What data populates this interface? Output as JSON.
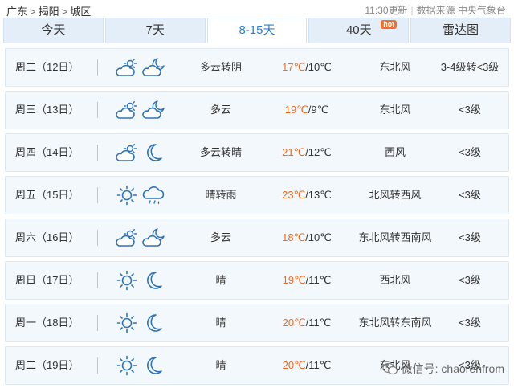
{
  "breadcrumb": {
    "province": "广东",
    "city": "揭阳",
    "district": "城区",
    "sep": ">"
  },
  "meta": {
    "updated": "11:30更新",
    "source": "数据来源 中央气象台",
    "divider": "|"
  },
  "tabs": [
    {
      "label": "今天"
    },
    {
      "label": "7天"
    },
    {
      "label": "8-15天",
      "active": true
    },
    {
      "label": "40天",
      "badge": "hot"
    },
    {
      "label": "雷达图"
    }
  ],
  "rows": [
    {
      "date": "周二（12日）",
      "icons": [
        "partly-cloudy-day-icon",
        "partly-cloudy-night-icon"
      ],
      "desc": "多云转阴",
      "high": "17℃",
      "low": "/10℃",
      "wind": "东北风",
      "level": "3-4级转<3级"
    },
    {
      "date": "周三（13日）",
      "icons": [
        "partly-cloudy-day-icon",
        "partly-cloudy-night-icon"
      ],
      "desc": "多云",
      "high": "19℃",
      "low": "/9℃",
      "wind": "东北风",
      "level": "<3级"
    },
    {
      "date": "周四（14日）",
      "icons": [
        "partly-cloudy-day-icon",
        "moon-icon"
      ],
      "desc": "多云转晴",
      "high": "21℃",
      "low": "/12℃",
      "wind": "西风",
      "level": "<3级"
    },
    {
      "date": "周五（15日）",
      "icons": [
        "sun-icon",
        "rain-cloud-icon"
      ],
      "desc": "晴转雨",
      "high": "23℃",
      "low": "/13℃",
      "wind": "北风转西风",
      "level": "<3级"
    },
    {
      "date": "周六（16日）",
      "icons": [
        "partly-cloudy-day-icon",
        "partly-cloudy-night-icon"
      ],
      "desc": "多云",
      "high": "18℃",
      "low": "/10℃",
      "wind": "东北风转西南风",
      "level": "<3级"
    },
    {
      "date": "周日（17日）",
      "icons": [
        "sun-icon",
        "moon-icon"
      ],
      "desc": "晴",
      "high": "19℃",
      "low": "/11℃",
      "wind": "西北风",
      "level": "<3级"
    },
    {
      "date": "周一（18日）",
      "icons": [
        "sun-icon",
        "moon-icon"
      ],
      "desc": "晴",
      "high": "20℃",
      "low": "/11℃",
      "wind": "东北风转东南风",
      "level": "<3级"
    },
    {
      "date": "周二（19日）",
      "icons": [
        "sun-icon",
        "moon-icon"
      ],
      "desc": "晴",
      "high": "20℃",
      "low": "/11℃",
      "wind": "东北风",
      "level": "<3级"
    }
  ],
  "watermark": {
    "text": "微信号: chaorenfrom",
    "icon": "wechat-icon"
  },
  "colors": {
    "accent": "#2a7fd4",
    "high_temp": "#f06a22",
    "icon_stroke": "#2e73b8",
    "hot_badge": "#f26d2b"
  }
}
